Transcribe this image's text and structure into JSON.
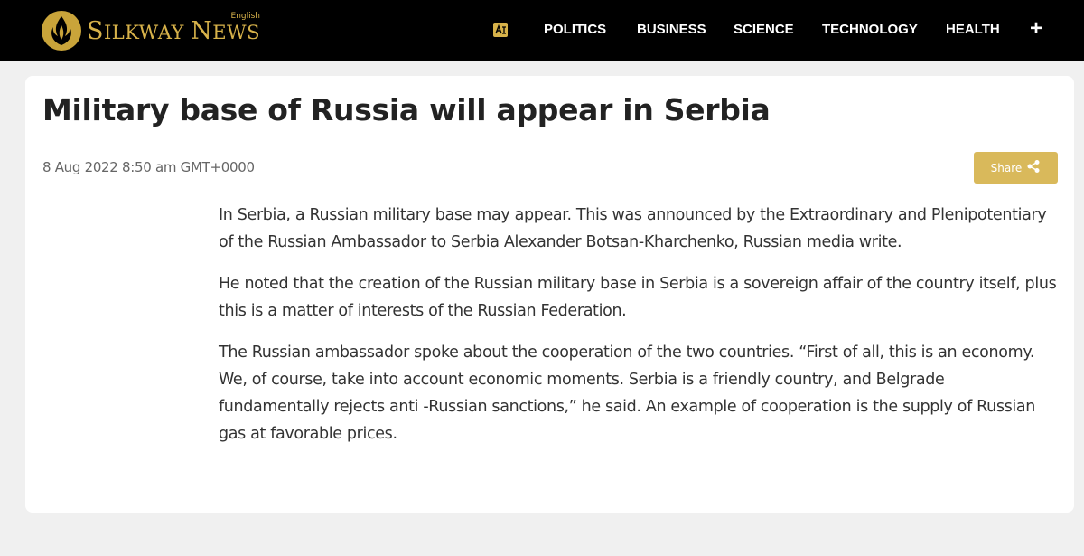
{
  "header": {
    "logo": {
      "brand_prefix": "S",
      "brand_rest": "ILKWAY ",
      "brand_word2_prefix": "N",
      "brand_word2_rest": "EWS",
      "language_tag": "English"
    },
    "language_icon": "language-switch-icon",
    "nav": [
      {
        "label": "POLITICS"
      },
      {
        "label": "BUSINESS"
      },
      {
        "label": "SCIENCE"
      },
      {
        "label": "TECHNOLOGY"
      },
      {
        "label": "HEALTH"
      }
    ],
    "more_label": "+"
  },
  "article": {
    "title": "Military base of Russia will appear in Serbia",
    "date": "8 Aug 2022 8:50 am GMT+0000",
    "share_label": "Share",
    "paragraphs": [
      "In Serbia, a Russian military base may appear. This was announced by the Extraordinary and Plenipotentiary of the Russian Ambassador to Serbia Alexander Botsan-Kharchenko, Russian media write.",
      "He noted that the creation of the Russian military base in Serbia is a sovereign affair of the country itself, plus this is a matter of interests of the Russian Federation.",
      "The Russian ambassador spoke about the cooperation of the two countries. “First of all, this is an economy. We, of course, take into account economic moments. Serbia is a friendly country, and Belgrade fundamentally rejects anti -Russian sanctions,” he said. An example of cooperation is the supply of Russian gas at favorable prices."
    ]
  },
  "colors": {
    "header_bg": "#000000",
    "brand_gold": "#d7b24a",
    "share_bg": "#d9b95b",
    "page_bg": "#f0f0f0"
  }
}
